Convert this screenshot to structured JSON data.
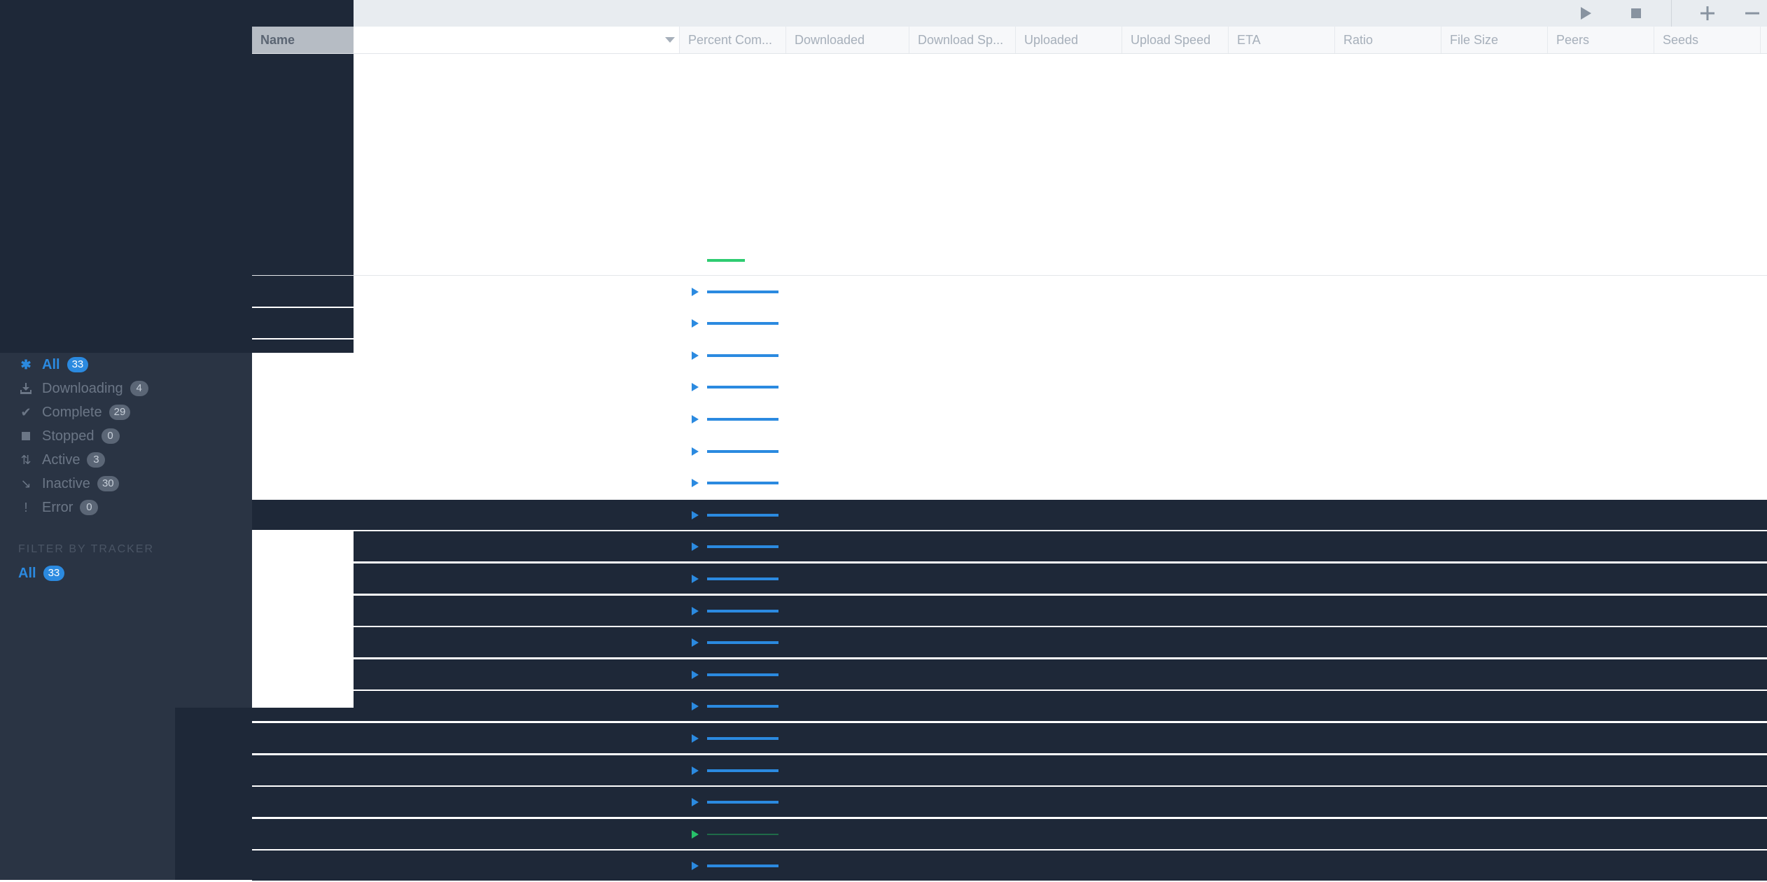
{
  "toolbar": {
    "start_label": "Start",
    "stop_label": "Stop",
    "add_label": "Add",
    "remove_label": "Remove"
  },
  "columns": [
    {
      "label": "Name"
    },
    {
      "label": "Percent Com..."
    },
    {
      "label": "Downloaded"
    },
    {
      "label": "Download Sp..."
    },
    {
      "label": "Uploaded"
    },
    {
      "label": "Upload Speed"
    },
    {
      "label": "ETA"
    },
    {
      "label": "Ratio"
    },
    {
      "label": "File Size"
    },
    {
      "label": "Peers"
    },
    {
      "label": "Seeds"
    }
  ],
  "filters": {
    "status": [
      {
        "label": "All",
        "count": "33",
        "icon": "asterisk-icon",
        "active": true
      },
      {
        "label": "Downloading",
        "count": "4",
        "icon": "download-icon"
      },
      {
        "label": "Complete",
        "count": "29",
        "icon": "checkmark-icon"
      },
      {
        "label": "Stopped",
        "count": "0",
        "icon": "stop-square-icon"
      },
      {
        "label": "Active",
        "count": "3",
        "icon": "active-arrows-icon"
      },
      {
        "label": "Inactive",
        "count": "30",
        "icon": "inactive-icon"
      },
      {
        "label": "Error",
        "count": "0",
        "icon": "exclamation-icon"
      }
    ],
    "tracker_title": "FILTER BY TRACKER",
    "tracker": [
      {
        "label": "All",
        "count": "33"
      }
    ]
  },
  "rows": [
    {
      "status": "downloading",
      "progress": 0.53
    },
    {
      "status": "complete",
      "progress": 1.0
    },
    {
      "status": "complete",
      "progress": 1.0
    },
    {
      "status": "complete",
      "progress": 1.0
    },
    {
      "status": "complete",
      "progress": 1.0
    },
    {
      "status": "complete",
      "progress": 1.0
    },
    {
      "status": "complete",
      "progress": 1.0
    },
    {
      "status": "complete",
      "progress": 1.0
    },
    {
      "status": "complete",
      "progress": 1.0
    },
    {
      "status": "complete",
      "progress": 1.0
    },
    {
      "status": "complete",
      "progress": 1.0
    },
    {
      "status": "complete",
      "progress": 1.0
    },
    {
      "status": "complete",
      "progress": 1.0
    },
    {
      "status": "complete",
      "progress": 1.0
    },
    {
      "status": "complete",
      "progress": 1.0
    },
    {
      "status": "complete",
      "progress": 1.0
    },
    {
      "status": "complete",
      "progress": 1.0
    },
    {
      "status": "complete",
      "progress": 1.0
    },
    {
      "status": "seeding",
      "progress": 1.0
    },
    {
      "status": "complete",
      "progress": 1.0
    }
  ],
  "colors": {
    "accent": "#2b8ae0",
    "progress_downloading": "#2ecc71",
    "progress_complete": "#2b8ae0",
    "sidebar_bg": "#2a3444",
    "dark_bg": "#1e2838"
  }
}
